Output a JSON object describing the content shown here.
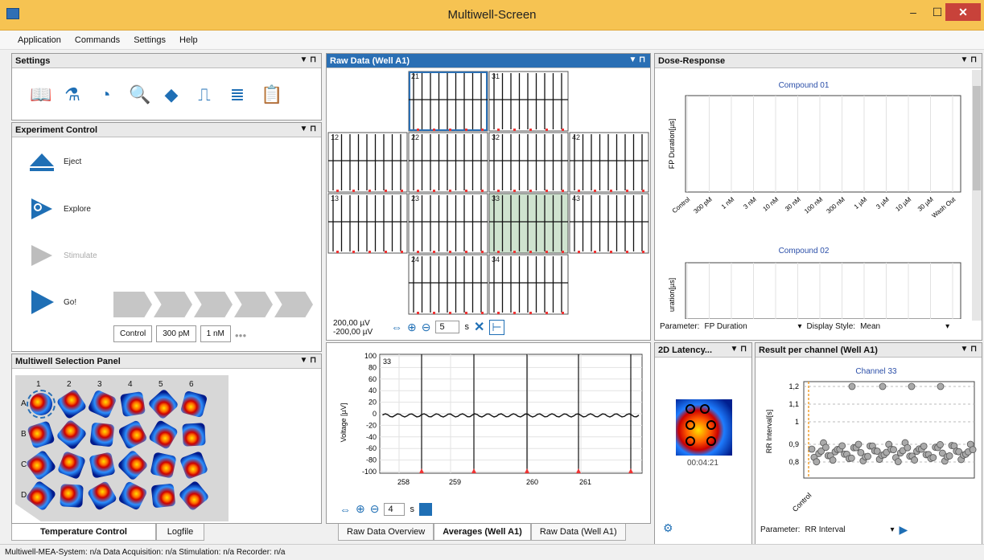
{
  "window": {
    "title": "Multiwell-Screen",
    "min": "–",
    "max": "☐",
    "close": "✕"
  },
  "menu": [
    "Application",
    "Commands",
    "Settings",
    "Help"
  ],
  "settings_panel": {
    "title": "Settings",
    "icons": [
      "book-icon",
      "flask-icon",
      "chart-pie-icon",
      "magnifier-icon",
      "eraser-icon",
      "pulse-icon",
      "database-icon",
      "clipboard-icon"
    ]
  },
  "experiment_control": {
    "title": "Experiment Control",
    "eject": "Eject",
    "explore": "Explore",
    "stimulate": "Stimulate",
    "go": "Go!",
    "concentrations": [
      "Control",
      "300 pM",
      "1 nM"
    ],
    "more": "●●●"
  },
  "multiwell": {
    "title": "Multiwell Selection Panel",
    "columns": [
      "1",
      "2",
      "3",
      "4",
      "5",
      "6"
    ],
    "rows": [
      "A",
      "B",
      "C",
      "D"
    ]
  },
  "left_tabs": [
    "Temperature Control",
    "Logfile"
  ],
  "raw_data": {
    "title": "Raw Data (Well A1)",
    "grid_labels": [
      "21",
      "31",
      "12",
      "22",
      "32",
      "42",
      "13",
      "23",
      "33",
      "43",
      "24",
      "34"
    ],
    "scale_top": "200,00 µV",
    "scale_bottom": "-200,00 µV",
    "time_value": "5",
    "time_unit": "s"
  },
  "averages": {
    "channel": "33",
    "ylabel": "Voltage [µV]",
    "yticks": [
      "100",
      "80",
      "60",
      "40",
      "20",
      "0",
      "-20",
      "-40",
      "-60",
      "-80",
      "-100"
    ],
    "xticks": [
      "258",
      "259",
      "260",
      "261"
    ],
    "time_value": "4",
    "time_unit": "s"
  },
  "center_tabs": [
    "Raw Data Overview",
    "Averages (Well A1)",
    "Raw Data (Well A1)"
  ],
  "dose_response": {
    "title": "Dose-Response",
    "compound1": "Compound 01",
    "compound2": "Compound 02",
    "ylabel": "FP Duration[µs]",
    "ylabel2": "uration[µs]",
    "xticks": [
      "Control",
      "300 pM",
      "1 nM",
      "3 nM",
      "10 nM",
      "30 nM",
      "100 nM",
      "300 nM",
      "1 µM",
      "3 µM",
      "10 µM",
      "30 µM",
      "Wash Out"
    ],
    "parameter_label": "Parameter:",
    "parameter_value": "FP Duration",
    "display_label": "Display Style:",
    "display_value": "Mean"
  },
  "latency": {
    "title": "2D Latency...",
    "time": "00:04:21"
  },
  "result": {
    "title": "Result per channel (Well A1)",
    "chart_title": "Channel 33",
    "ylabel": "RR Interval[s]",
    "yticks": [
      "1,2",
      "1,1",
      "1",
      "0,9",
      "0,8"
    ],
    "xtick": "Control",
    "parameter_label": "Parameter:",
    "parameter_value": "RR Interval"
  },
  "status": "Multiwell-MEA-System: n/a  Data Acquisition: n/a  Stimulation: n/a  Recorder: n/a"
}
